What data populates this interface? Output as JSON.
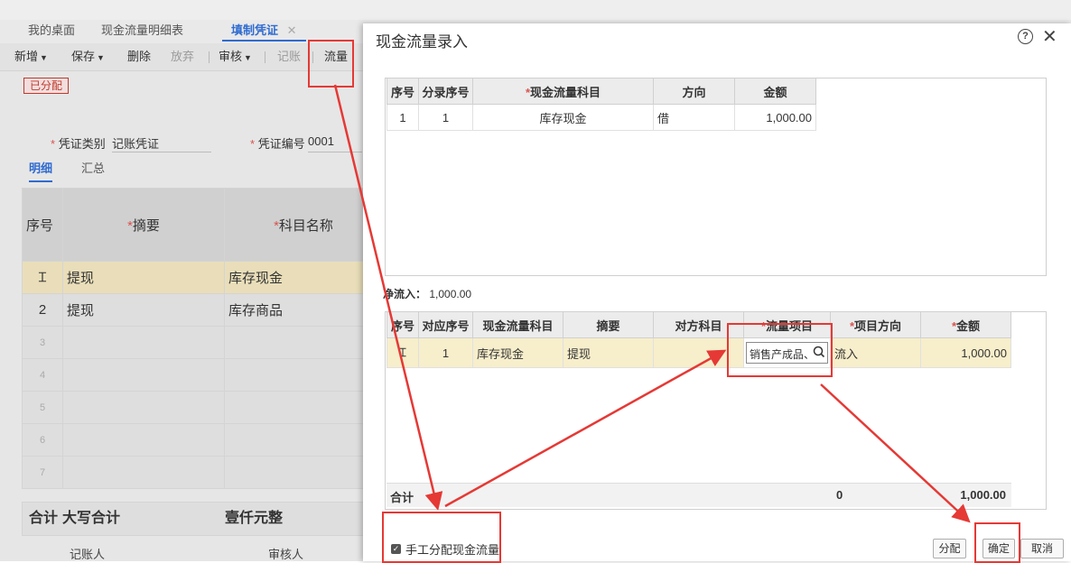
{
  "tabs": [
    {
      "label": "我的桌面"
    },
    {
      "label": "现金流量明细表"
    },
    {
      "label": "填制凭证",
      "close": "✕"
    }
  ],
  "toolbar": {
    "new": "新增",
    "save": "保存",
    "delete": "删除",
    "discard": "放弃",
    "audit": "审核",
    "post": "记账",
    "flow": "流量"
  },
  "status_badge": "已分配",
  "form": {
    "voucher_type_label": "凭证类别",
    "voucher_type_value": "记账凭证",
    "voucher_no_label": "凭证编号",
    "voucher_no_value": "0001"
  },
  "subtabs": [
    "明细",
    "汇总"
  ],
  "entry_table": {
    "headers": [
      "序号",
      "摘要",
      "科目名称"
    ],
    "rows": [
      {
        "no": "",
        "summary": "提现",
        "account": "库存现金"
      },
      {
        "no": "2",
        "summary": "提现",
        "account": "库存商品"
      },
      {
        "no": "3",
        "summary": "",
        "account": ""
      },
      {
        "no": "4",
        "summary": "",
        "account": ""
      },
      {
        "no": "5",
        "summary": "",
        "account": ""
      },
      {
        "no": "6",
        "summary": "",
        "account": ""
      },
      {
        "no": "7",
        "summary": "",
        "account": ""
      }
    ],
    "total_label": "合计",
    "total_caps_label": "大写合计",
    "total_caps_value": "壹仟元整"
  },
  "footer": {
    "bookkeeper": "记账人",
    "auditor": "审核人"
  },
  "dialog": {
    "title": "现金流量录入",
    "top_table": {
      "headers": [
        "序号",
        "分录序号",
        "现金流量科目",
        "方向",
        "金额"
      ],
      "rows": [
        {
          "no": "1",
          "entry_no": "1",
          "subject": "库存现金",
          "direction": "借",
          "amount": "1,000.00"
        }
      ]
    },
    "net_inflow_label": "净流入：",
    "net_inflow_value": "1,000.00",
    "bottom_table": {
      "headers": [
        "序号",
        "对应序号",
        "现金流量科目",
        "摘要",
        "对方科目",
        "流量项目",
        "项目方向",
        "金额"
      ],
      "rows": [
        {
          "no": "",
          "corr_no": "1",
          "subject": "库存现金",
          "summary": "提现",
          "counter": "",
          "flow_item": "销售产成品、",
          "item_direction": "流入",
          "amount": "1,000.00"
        }
      ],
      "total_label": "合计",
      "total_mid": "0",
      "total_amount": "1,000.00"
    },
    "manual_alloc_label": "手工分配现金流量",
    "buttons": {
      "allocate": "分配",
      "confirm": "确定",
      "cancel": "取消"
    }
  },
  "colors": {
    "accent": "#2e6bd1",
    "annotation": "#e53935",
    "highlight_row": "#f7eecb"
  }
}
